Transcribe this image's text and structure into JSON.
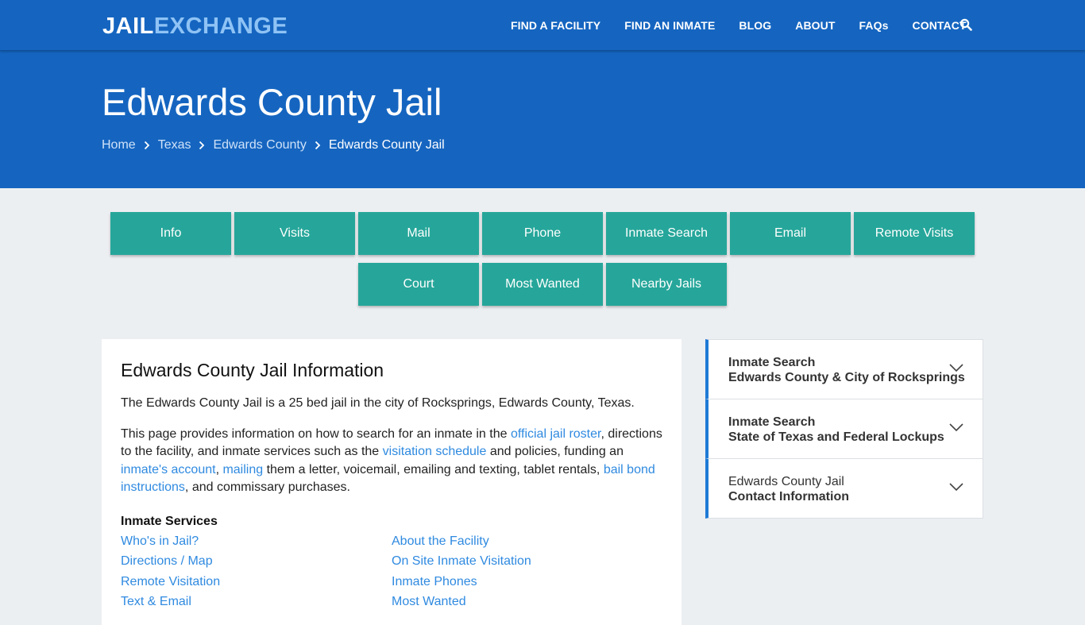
{
  "header": {
    "logo_part1": "JAIL",
    "logo_part2": "EXCHANGE",
    "nav": [
      "FIND A FACILITY",
      "FIND AN INMATE",
      "BLOG",
      "ABOUT",
      "FAQs",
      "CONTACT"
    ],
    "search_icon": "search-icon"
  },
  "hero": {
    "title": "Edwards County Jail",
    "breadcrumb": [
      "Home",
      "Texas",
      "Edwards County",
      "Edwards County Jail"
    ]
  },
  "tabs": [
    "Info",
    "Visits",
    "Mail",
    "Phone",
    "Inmate Search",
    "Email",
    "Remote Visits",
    "Court",
    "Most Wanted",
    "Nearby Jails"
  ],
  "main": {
    "heading": "Edwards County Jail Information",
    "para1": "The Edwards County Jail is a 25 bed jail in the city of Rocksprings, Edwards County, Texas.",
    "para2": {
      "t1": "This page provides information on how to search for an inmate in the ",
      "link1": "official jail roster",
      "t2": ", directions to the facility, and inmate services such as the ",
      "link2": "visitation schedule",
      "t3": " and policies, funding an ",
      "link3": "inmate's account",
      "t4": ", ",
      "link4": "mailing",
      "t5": " them a letter, voicemail, emailing and texting, tablet rentals, ",
      "link5": "bail bond instructions",
      "t6": ", and commissary purchases."
    },
    "services_title": "Inmate Services",
    "services": [
      "Who's in Jail?",
      "About the Facility",
      "Directions / Map",
      "On Site Inmate Visitation",
      "Remote Visitation",
      "Inmate Phones",
      "Text & Email",
      "Most Wanted"
    ]
  },
  "sidebar": {
    "items": [
      {
        "line1": "Inmate Search",
        "line2": "Edwards County & City of Rocksprings",
        "line1_bold": true
      },
      {
        "line1": "Inmate Search",
        "line2": "State of Texas and Federal Lockups",
        "line1_bold": true
      },
      {
        "line1": "Edwards County Jail",
        "line2": "Contact Information",
        "line1_bold": false
      }
    ],
    "chevron_icon": "chevron-down-icon"
  },
  "colors": {
    "brand_blue": "#1565c0",
    "tab_teal": "#26a69a",
    "link_blue": "#2f8ae0",
    "accent_border": "#1e7ad6"
  }
}
